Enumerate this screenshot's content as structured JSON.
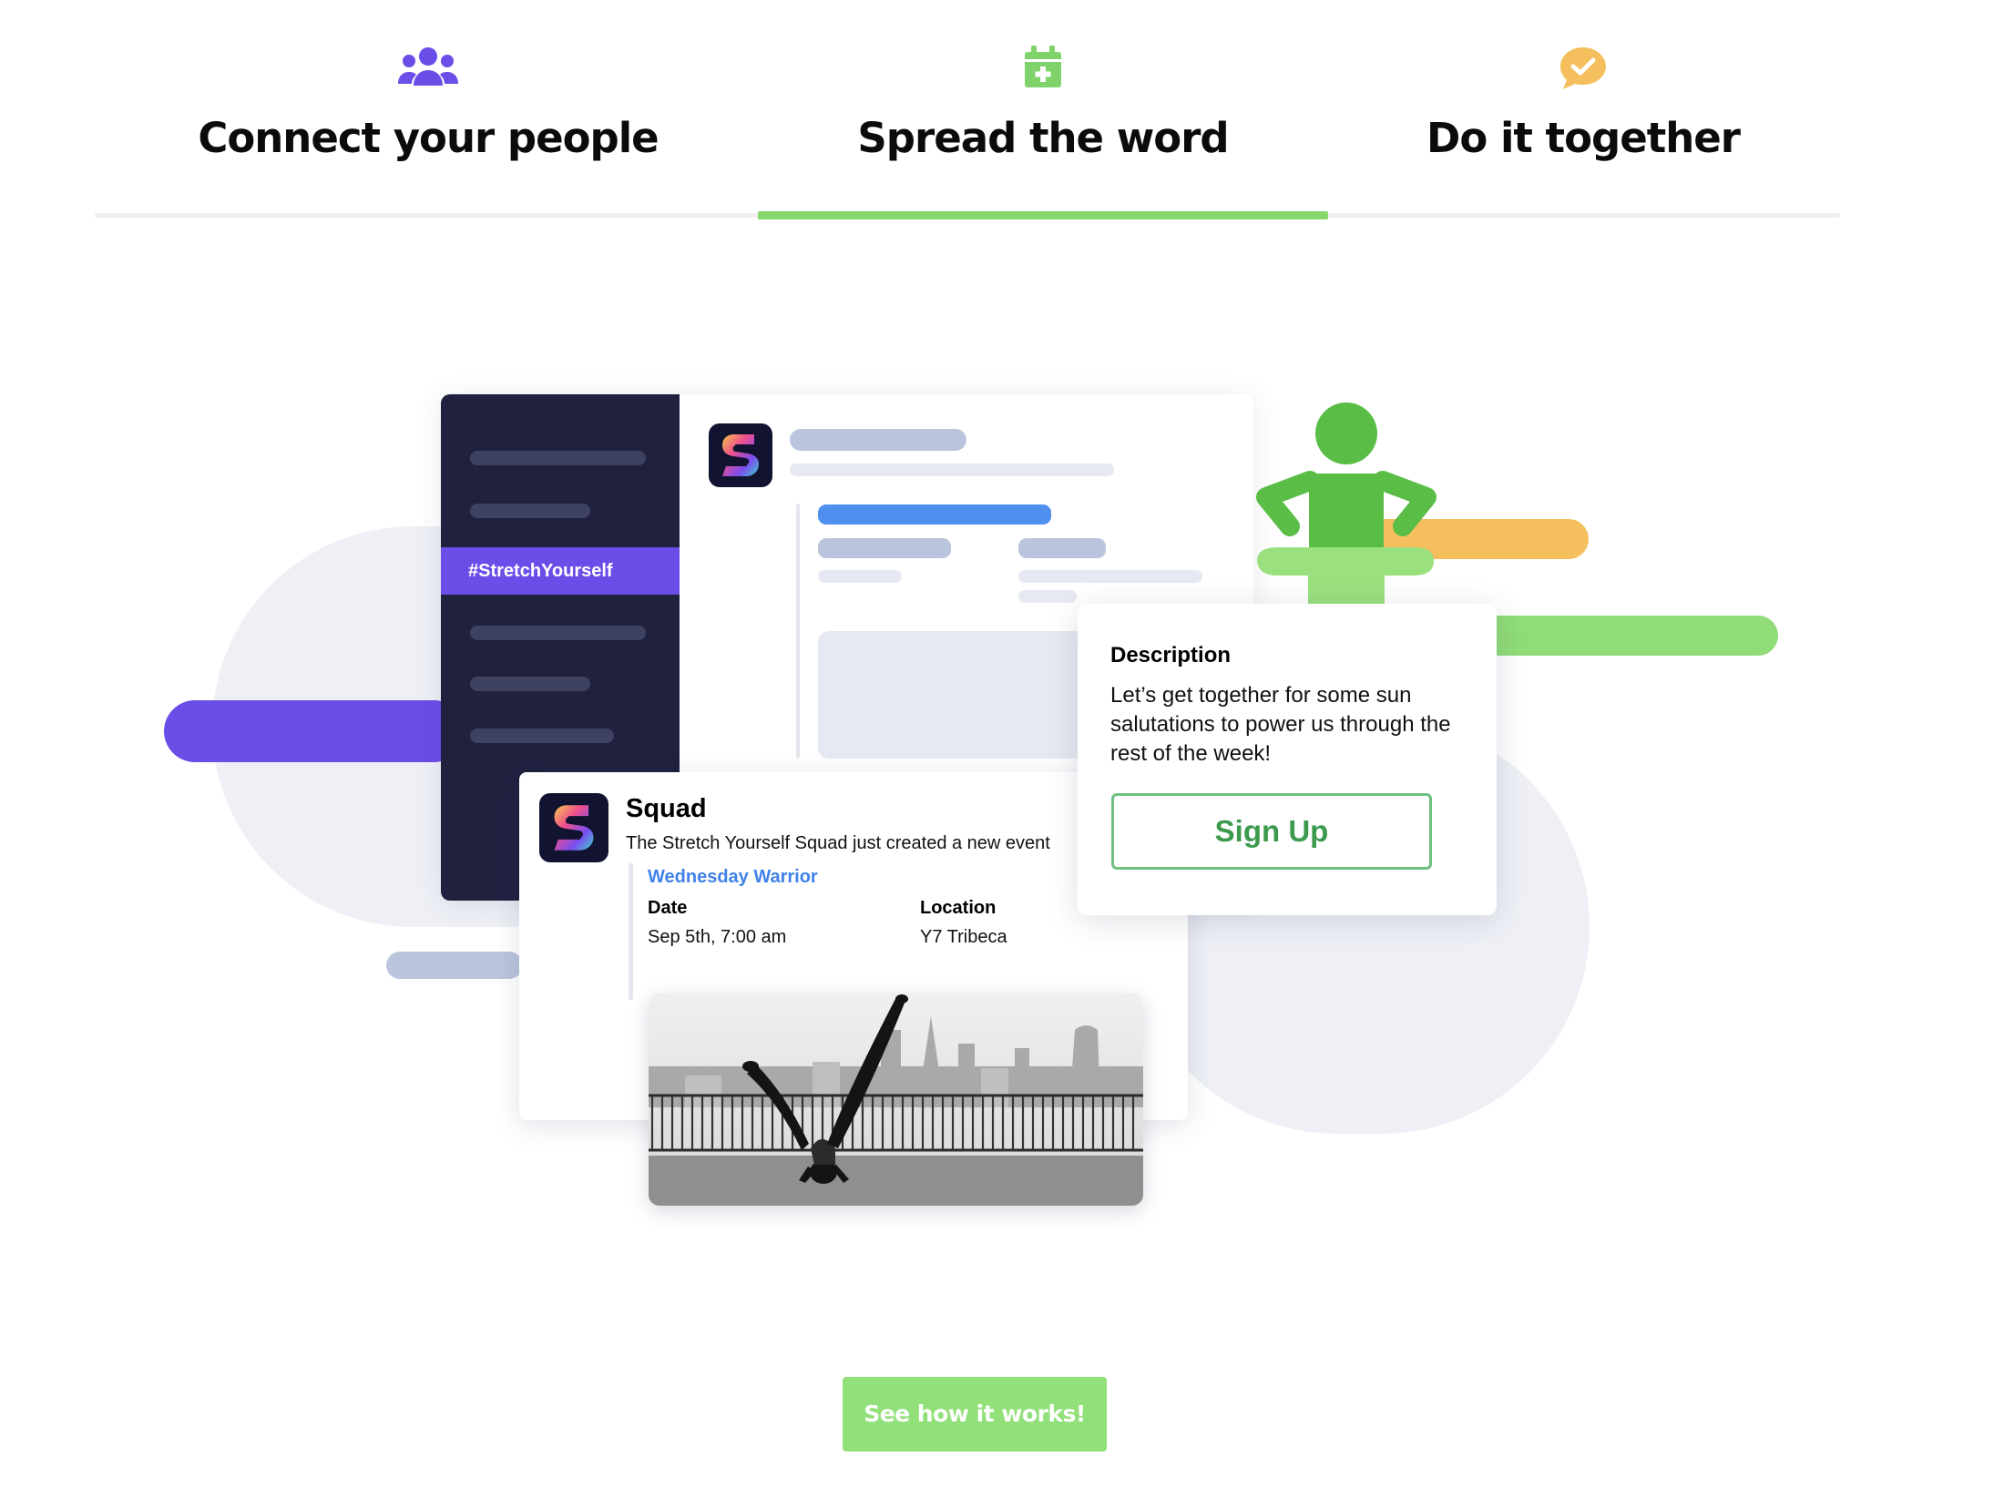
{
  "tabs": [
    {
      "label": "Connect your people",
      "icon": "people-icon",
      "active": false,
      "icon_color": "#6b4de8"
    },
    {
      "label": "Spread the word",
      "icon": "calendar-add-icon",
      "active": true,
      "icon_color": "#7fd36a"
    },
    {
      "label": "Do it together",
      "icon": "chat-check-icon",
      "active": false,
      "icon_color": "#f4bf5c"
    }
  ],
  "colors": {
    "accent_green": "#86d86b",
    "purple": "#6b4de8",
    "navy": "#20213f",
    "orange": "#f4bf5c",
    "link_blue": "#3f82e8"
  },
  "illustration": {
    "sidebar": {
      "channel": "#StretchYourself"
    },
    "event_card": {
      "app_name": "Squad",
      "message": "The Stretch Yourself Squad just created a new event",
      "event_title": "Wednesday Warrior",
      "date_label": "Date",
      "date_value": "Sep 5th, 7:00 am",
      "location_label": "Location",
      "location_value": "Y7 Tribeca"
    },
    "popup": {
      "title": "Description",
      "text": "Let’s get together for some sun salutations to power us through the rest of the week!",
      "button": "Sign Up"
    }
  },
  "cta": {
    "label": "See how it works!"
  }
}
